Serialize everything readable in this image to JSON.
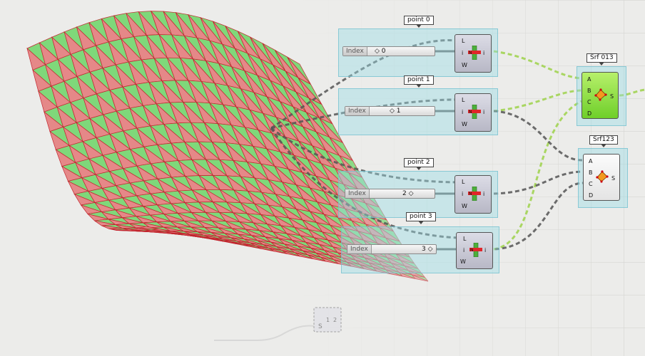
{
  "components": {
    "point0": {
      "tag": "point 0",
      "slider_label": "Index",
      "slider_value": "0",
      "inputs": [
        "L",
        "i",
        "W"
      ],
      "output": "i"
    },
    "point1": {
      "tag": "point 1",
      "slider_label": "Index",
      "slider_value": "1",
      "inputs": [
        "L",
        "i",
        "W"
      ],
      "output": "i"
    },
    "point2": {
      "tag": "point 2",
      "slider_label": "Index",
      "slider_value": "2",
      "inputs": [
        "L",
        "i",
        "W"
      ],
      "output": "i"
    },
    "point3": {
      "tag": "point 3",
      "slider_label": "Index",
      "slider_value": "3",
      "inputs": [
        "L",
        "i",
        "W"
      ],
      "output": "i"
    },
    "srf013": {
      "tag": "Srf 013",
      "inputs": [
        "A",
        "B",
        "C",
        "D"
      ],
      "output": "S"
    },
    "srf123": {
      "tag": "Srf123",
      "inputs": [
        "A",
        "B",
        "C",
        "D"
      ],
      "output": "S"
    },
    "faded_component": {
      "inputs": [
        "S"
      ],
      "values": [
        "1",
        "2"
      ]
    }
  },
  "colors": {
    "canvas": "#ececea",
    "grid": "#cfcfcb",
    "mesh_green": "#7fd87a",
    "mesh_red": "#e58888",
    "mesh_edge": "#c2252e",
    "wire_dark": "#555555",
    "wire_green": "#9ed24a",
    "group_fill": "#9fdde6"
  },
  "icons": [
    "list-item-icon",
    "four-point-surface-icon"
  ]
}
